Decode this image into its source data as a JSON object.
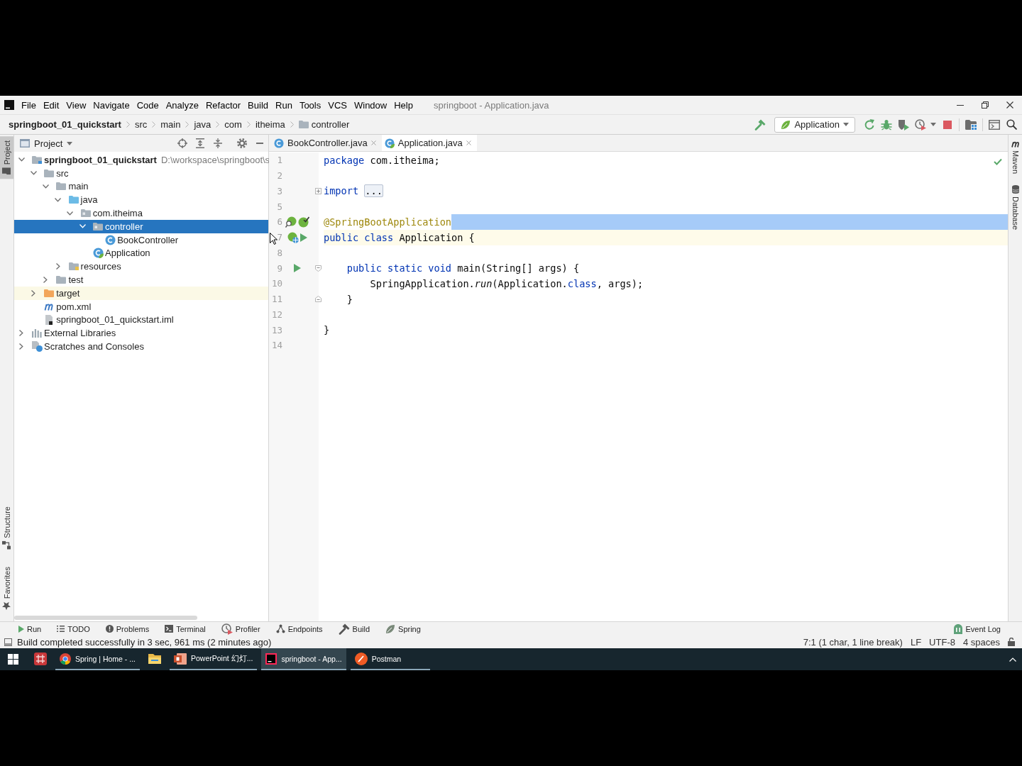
{
  "menu_bar": {
    "items": [
      "File",
      "Edit",
      "View",
      "Navigate",
      "Code",
      "Analyze",
      "Refactor",
      "Build",
      "Run",
      "Tools",
      "VCS",
      "Window",
      "Help"
    ],
    "title": "springboot - Application.java"
  },
  "navigation_bar": {
    "breadcrumbs": [
      {
        "label": "springboot_01_quickstart",
        "kind": "project"
      },
      {
        "label": "src",
        "kind": "plain"
      },
      {
        "label": "main",
        "kind": "plain"
      },
      {
        "label": "java",
        "kind": "plain"
      },
      {
        "label": "com",
        "kind": "plain"
      },
      {
        "label": "itheima",
        "kind": "plain"
      },
      {
        "label": "controller",
        "kind": "folder"
      }
    ],
    "run_configuration": "Application"
  },
  "left_tool_strip": [
    {
      "label": "Project",
      "kind": "project",
      "selected": true
    },
    {
      "label": "Structure",
      "kind": "structure",
      "selected": false
    },
    {
      "label": "Favorites",
      "kind": "favorites",
      "selected": false
    }
  ],
  "project_panel": {
    "title": "Project",
    "tree": [
      {
        "label": "springboot_01_quickstart",
        "path": "D:\\workspace\\springboot\\s",
        "kind": "module",
        "expanded": true,
        "selected": false,
        "children": [
          {
            "label": "src",
            "kind": "folder",
            "expanded": true,
            "selected": false,
            "children": [
              {
                "label": "main",
                "kind": "folder",
                "expanded": true,
                "selected": false,
                "children": [
                  {
                    "label": "java",
                    "kind": "source-root",
                    "expanded": true,
                    "selected": false,
                    "children": [
                      {
                        "label": "com.itheima",
                        "kind": "package",
                        "expanded": true,
                        "selected": false,
                        "children": [
                          {
                            "label": "controller",
                            "kind": "package",
                            "expanded": true,
                            "selected": true,
                            "children": [
                              {
                                "label": "BookController",
                                "kind": "class",
                                "selected": false
                              }
                            ]
                          },
                          {
                            "label": "Application",
                            "kind": "spring-app",
                            "selected": false
                          }
                        ]
                      }
                    ]
                  },
                  {
                    "label": "resources",
                    "kind": "resources-root",
                    "expanded": false,
                    "selected": false
                  }
                ]
              },
              {
                "label": "test",
                "kind": "folder",
                "expanded": false,
                "selected": false
              }
            ]
          },
          {
            "label": "target",
            "kind": "excluded-folder",
            "expanded": false,
            "selected": false
          },
          {
            "label": "pom.xml",
            "kind": "maven",
            "selected": false
          },
          {
            "label": "springboot_01_quickstart.iml",
            "kind": "iml",
            "selected": false
          }
        ]
      },
      {
        "label": "External Libraries",
        "kind": "libraries",
        "expanded": false,
        "selected": false
      },
      {
        "label": "Scratches and Consoles",
        "kind": "scratches",
        "expanded": false,
        "selected": false
      }
    ]
  },
  "editor": {
    "tabs": [
      {
        "label": "BookController.java",
        "kind": "class",
        "selected": false
      },
      {
        "label": "Application.java",
        "kind": "spring-app",
        "selected": true
      }
    ],
    "lines": [
      {
        "number": "1",
        "tokens": [
          {
            "text": "package",
            "kind": "keyword"
          },
          {
            "text": " com.itheima;",
            "kind": "plain"
          }
        ],
        "selected": false,
        "current": false
      },
      {
        "number": "2",
        "selected": false,
        "current": false
      },
      {
        "number": "3",
        "tokens": [
          {
            "text": "import ",
            "kind": "keyword"
          },
          {
            "text": "...",
            "kind": "folded"
          }
        ],
        "fold": {
          "kind": "collapsed"
        },
        "selected": false,
        "current": false
      },
      {
        "number": "5",
        "selected": false,
        "current": false
      },
      {
        "number": "6",
        "tokens": [
          {
            "text": "@SpringBootApplication",
            "kind": "annotation"
          }
        ],
        "markers": [
          {
            "kind": "bean-search"
          },
          {
            "kind": "bean-check"
          }
        ],
        "selected": true,
        "current": false
      },
      {
        "number": "7",
        "tokens": [
          {
            "text": "public class",
            "kind": "keyword"
          },
          {
            "text": " Application {",
            "kind": "plain"
          }
        ],
        "markers": [
          {
            "kind": "bean-web"
          },
          {
            "kind": "run"
          }
        ],
        "selected": false,
        "current": true
      },
      {
        "number": "8",
        "selected": false,
        "current": false
      },
      {
        "number": "9",
        "tokens": [
          {
            "text": "    public static void",
            "kind": "keyword"
          },
          {
            "text": " main(String[] args) {",
            "kind": "plain"
          }
        ],
        "markers": [
          {
            "kind": "run"
          }
        ],
        "fold": {
          "kind": "start"
        },
        "selected": false,
        "current": false
      },
      {
        "number": "10",
        "tokens": [
          {
            "text": "        SpringApplication.",
            "kind": "plain"
          },
          {
            "text": "run",
            "kind": "static-call"
          },
          {
            "text": "(Application.",
            "kind": "plain"
          },
          {
            "text": "class",
            "kind": "keyword"
          },
          {
            "text": ", args);",
            "kind": "plain"
          }
        ],
        "selected": false,
        "current": false
      },
      {
        "number": "11",
        "tokens": [
          {
            "text": "    }",
            "kind": "plain"
          }
        ],
        "fold": {
          "kind": "end"
        },
        "selected": false,
        "current": false
      },
      {
        "number": "12",
        "selected": false,
        "current": false
      },
      {
        "number": "13",
        "tokens": [
          {
            "text": "}",
            "kind": "plain"
          }
        ],
        "selected": false,
        "current": false
      },
      {
        "number": "14",
        "selected": false,
        "current": false
      }
    ]
  },
  "right_tool_strip": [
    {
      "label": "Maven",
      "kind": "maven",
      "selected": false
    },
    {
      "label": "Database",
      "kind": "database",
      "selected": false
    }
  ],
  "tool_window_bar": {
    "items": [
      {
        "label": "Run",
        "kind": "run",
        "selected": false
      },
      {
        "label": "TODO",
        "kind": "todo",
        "selected": false
      },
      {
        "label": "Problems",
        "kind": "problems",
        "selected": false
      },
      {
        "label": "Terminal",
        "kind": "terminal",
        "selected": false
      },
      {
        "label": "Profiler",
        "kind": "profiler",
        "selected": false
      },
      {
        "label": "Endpoints",
        "kind": "endpoints",
        "selected": false
      },
      {
        "label": "Build",
        "kind": "build",
        "selected": false
      },
      {
        "label": "Spring",
        "kind": "spring",
        "selected": false
      }
    ],
    "event_log": "Event Log"
  },
  "status_bar": {
    "message": "Build completed successfully in 3 sec, 961 ms (2 minutes ago)",
    "caret_position": "7:1 (1 char, 1 line break)",
    "line_separator": "LF",
    "encoding": "UTF-8",
    "indent": "4 spaces"
  },
  "taskbar": {
    "items": [
      {
        "kind": "app",
        "selected": false,
        "running": false
      },
      {
        "label": "Spring | Home - ...",
        "kind": "browser",
        "selected": false,
        "running": true
      },
      {
        "kind": "explorer",
        "selected": false,
        "running": false
      },
      {
        "label": "PowerPoint 幻灯...",
        "kind": "slides",
        "selected": false,
        "running": true
      },
      {
        "label": "springboot - App...",
        "kind": "ide",
        "selected": true,
        "running": true
      },
      {
        "label": "Postman",
        "kind": "postman",
        "selected": false,
        "running": true
      }
    ]
  }
}
